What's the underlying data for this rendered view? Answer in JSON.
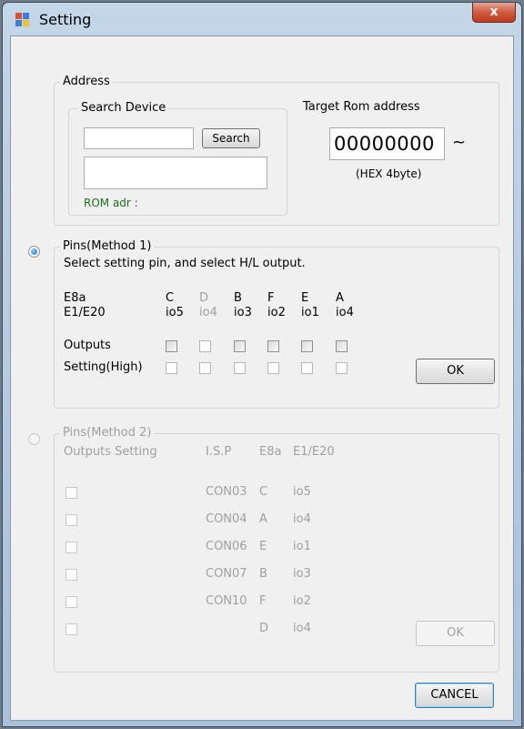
{
  "window": {
    "title": "Setting",
    "close_glyph": "x"
  },
  "address": {
    "group_label": "Address",
    "search_device": {
      "label": "Search Device",
      "input_value": "",
      "search_button": "Search",
      "result_value": "",
      "rom_adr_label": "ROM adr :"
    },
    "target_rom": {
      "label": "Target Rom address",
      "value": "00000000",
      "suffix": "~",
      "note": "(HEX 4byte)"
    }
  },
  "method1": {
    "selected": true,
    "group_label": "Pins(Method  1)",
    "instruction": "Select setting pin, and select H/L output.",
    "row1_label": "E8a",
    "row2_label": "E1/E20",
    "columns": [
      {
        "e8a": "C",
        "e1": "io5",
        "enabled": true
      },
      {
        "e8a": "D",
        "e1": "io4",
        "enabled": false
      },
      {
        "e8a": "B",
        "e1": "io3",
        "enabled": true
      },
      {
        "e8a": "F",
        "e1": "io2",
        "enabled": true
      },
      {
        "e8a": "E",
        "e1": "io1",
        "enabled": true
      },
      {
        "e8a": "A",
        "e1": "io4",
        "enabled": true
      }
    ],
    "outputs_label": "Outputs",
    "setting_label": "Setting(High)",
    "ok_button": "OK"
  },
  "method2": {
    "selected": false,
    "group_label": "Pins(Method  2)",
    "headers": {
      "outputs_setting": "Outputs  Setting",
      "isp": "I.S.P",
      "e8a": "E8a",
      "e1": "E1/E20"
    },
    "rows": [
      {
        "isp": "CON03",
        "e8a": "C",
        "e1": "io5"
      },
      {
        "isp": "CON04",
        "e8a": "A",
        "e1": "io4"
      },
      {
        "isp": "CON06",
        "e8a": "E",
        "e1": "io1"
      },
      {
        "isp": "CON07",
        "e8a": "B",
        "e1": "io3"
      },
      {
        "isp": "CON10",
        "e8a": "F",
        "e1": "io2"
      },
      {
        "isp": "",
        "e8a": "D",
        "e1": "io4"
      }
    ],
    "ok_button": "OK"
  },
  "cancel_button": "CANCEL",
  "colors": {
    "titlebar": "#b2c9df",
    "client": "#f0f0f0",
    "accent_green": "#1f6f1f",
    "disabled_text": "#a0a0a0"
  }
}
